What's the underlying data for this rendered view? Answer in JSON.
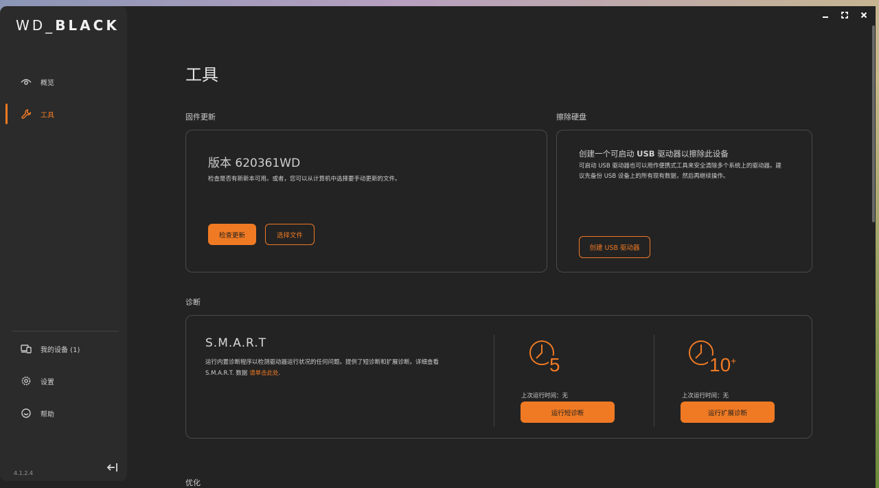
{
  "app": {
    "logo_text": "WD_BLACK",
    "version": "4.1.2.4"
  },
  "window_controls": {
    "minimize": "minimize",
    "maximize": "maximize",
    "close": "close"
  },
  "sidebar": {
    "items": [
      {
        "label": "概览",
        "icon": "eye-icon"
      },
      {
        "label": "工具",
        "icon": "wrench-icon",
        "active": true
      },
      {
        "label": "我的设备 (1)",
        "icon": "devices-icon"
      },
      {
        "label": "设置",
        "icon": "gear-icon"
      },
      {
        "label": "帮助",
        "icon": "help-icon"
      }
    ]
  },
  "main": {
    "title": "工具",
    "firmware": {
      "section": "固件更新",
      "version_label": "版本 620361WD",
      "description": "检查是否有新新本可用。或者，您可以从计算机中选择要手动更新的文件。",
      "check_button": "检查更新",
      "choose_button": "选择文件"
    },
    "erase": {
      "section": "擦除硬盘",
      "title_prefix": "创建一个可启动 ",
      "title_bold": "USB",
      "title_suffix": " 驱动器以擦除此设备",
      "description": "可启动 USB 驱动器也可以用作便携式工具来安全清除多个系统上的驱动器。建议先备份 USB 设备上的所有现有数据，然后再继续操作。",
      "button": "创建 USB 驱动器"
    },
    "diagnostics": {
      "section": "诊断",
      "title": "S.M.A.R.T",
      "description_line1": "运行内置诊断程序以检测驱动器运行状况的任何问题。提供了短诊断和扩展诊断。详细查看",
      "description_line2_prefix": "S.M.A.R.T. 数据 ",
      "link_text": "请单击此处",
      "link_suffix": ".",
      "short": {
        "number": "5",
        "last_run": "上次运行时间：无",
        "button": "运行短诊断"
      },
      "extended": {
        "number": "10",
        "plus": "+",
        "last_run": "上次运行时间：无",
        "button": "运行扩展诊断"
      }
    },
    "next_section": "优化"
  },
  "colors": {
    "accent": "#f07a24",
    "bg": "#232323",
    "sidebar": "#2b2b2b"
  }
}
